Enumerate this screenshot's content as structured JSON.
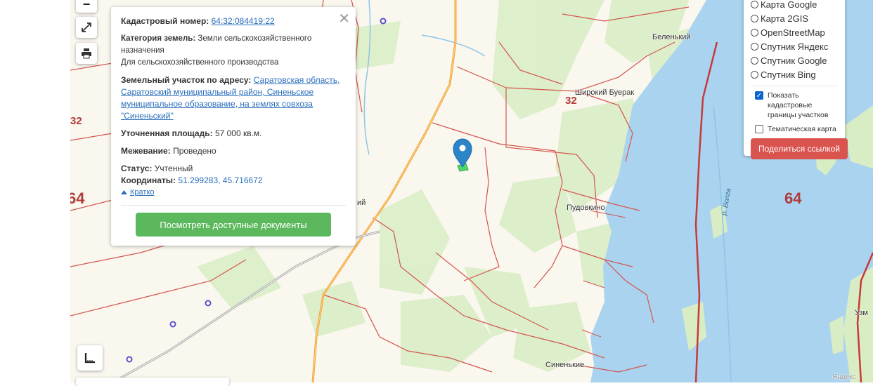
{
  "map": {
    "region_labels": [
      "32",
      "64"
    ],
    "river_label": "р. Волга",
    "places": [
      "Беленький",
      "Широкий Буерак",
      "Пудовкино",
      "Синенькие",
      "ий",
      "Узм"
    ],
    "watermark": "Яндекс"
  },
  "controls": {
    "zoom_out": "−"
  },
  "popup": {
    "cadastral_label": "Кадастровый номер:",
    "cadastral_number": "64:32:084419:22",
    "category_label": "Категория земель:",
    "category_value": "Земли сельскохозяйственного назначения",
    "category_use": "Для сельскохозяйственного производства",
    "address_label": "Земельный участок по адресу:",
    "address_value": "Саратовская область, Саратовский муниципальный район, Синеньское муниципальное образование, на землях совхоза \"Синеньский\"",
    "area_label": "Уточненная площадь:",
    "area_value": "57 000 кв.м.",
    "survey_label": "Межевание:",
    "survey_value": "Проведено",
    "status_label": "Статус:",
    "status_value": "Учтенный",
    "coords_label": "Координаты:",
    "coords_value": "51.299283, 45.716672",
    "collapse_label": "Кратко",
    "docs_button": "Посмотреть доступные документы",
    "close": "✕"
  },
  "layers": {
    "options": [
      "Карта Google",
      "Карта 2GIS",
      "OpenStreetMap",
      "Спутник Яндекс",
      "Спутник Google",
      "Спутник Bing"
    ],
    "show_borders_label": "Показать кадастровые границы участков",
    "show_borders_checked": true,
    "thematic_label": "Тематическая карта",
    "thematic_checked": false,
    "share_button": "Поделиться ссылкой"
  },
  "colors": {
    "water": "#a9d3ef",
    "border": "#d4554f",
    "road": "#f2a33a",
    "marker": "#2c85c8",
    "parcel": "#53d46a"
  }
}
